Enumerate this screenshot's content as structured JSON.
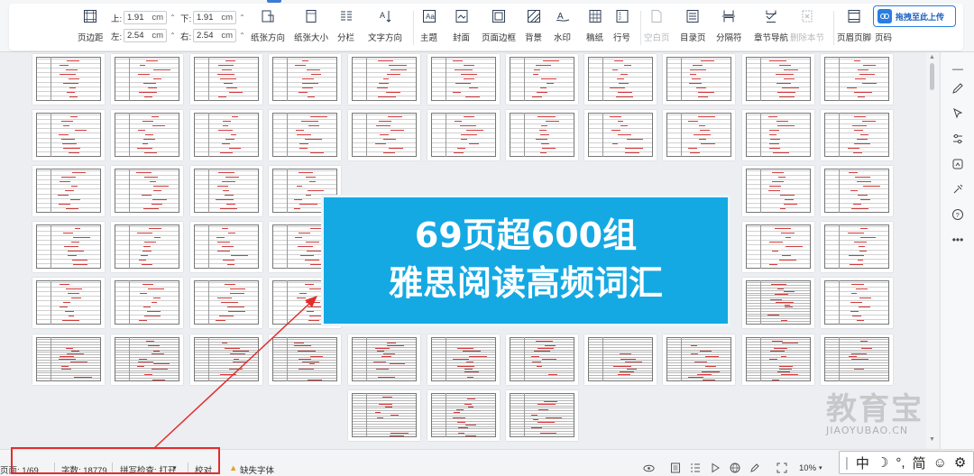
{
  "ribbon": {
    "tools": [
      {
        "id": "margins",
        "label": "页边距",
        "icon": "page-margins-icon"
      },
      {
        "id": "orientation",
        "label": "纸张方向",
        "icon": "orientation-icon"
      },
      {
        "id": "paper-size",
        "label": "纸张大小",
        "icon": "paper-size-icon"
      },
      {
        "id": "columns",
        "label": "分栏",
        "icon": "columns-icon"
      },
      {
        "id": "text-direction",
        "label": "文字方向",
        "icon": "text-direction-icon"
      },
      {
        "id": "theme",
        "label": "主题",
        "icon": "theme-icon"
      },
      {
        "id": "cover",
        "label": "封面",
        "icon": "cover-icon"
      },
      {
        "id": "page-border",
        "label": "页面边框",
        "icon": "page-border-icon"
      },
      {
        "id": "background",
        "label": "背景",
        "icon": "background-icon"
      },
      {
        "id": "watermark",
        "label": "水印",
        "icon": "watermark-icon"
      },
      {
        "id": "manuscript",
        "label": "稿纸",
        "icon": "manuscript-icon"
      },
      {
        "id": "line-number",
        "label": "行号",
        "icon": "line-number-icon"
      },
      {
        "id": "blank-page",
        "label": "空白页",
        "icon": "blank-page-icon",
        "disabled": true
      },
      {
        "id": "toc-page",
        "label": "目录页",
        "icon": "toc-page-icon"
      },
      {
        "id": "separator",
        "label": "分隔符",
        "icon": "separator-icon"
      },
      {
        "id": "section-nav",
        "label": "章节导航",
        "icon": "section-nav-icon"
      },
      {
        "id": "delete-section",
        "label": "删除本节",
        "icon": "delete-section-icon",
        "disabled": true
      },
      {
        "id": "header-footer",
        "label": "页眉页脚",
        "icon": "header-footer-icon"
      },
      {
        "id": "page-number",
        "label": "页码",
        "icon": "page-number-icon"
      }
    ],
    "margins": {
      "top_label": "上:",
      "top": "1.91",
      "bottom_label": "下:",
      "bottom": "1.91",
      "left_label": "左:",
      "left": "2.54",
      "right_label": "右:",
      "right": "2.54",
      "unit": "cm"
    },
    "upload_button": "拖拽至此上传"
  },
  "banner": {
    "line1": "69页超600组",
    "line2": "雅思阅读高频词汇"
  },
  "status": {
    "page": "页面: 1/69",
    "words": "字数: 18779",
    "spell_check": "拼写检查: 打开",
    "proof": "校对",
    "missing_font": "缺失字体",
    "zoom": "10%"
  },
  "watermark": {
    "cn": "教育宝",
    "en": "JIAOYUBAO.CN"
  },
  "ime": {
    "mode": "中",
    "punct": "°,",
    "script": "简"
  },
  "colors": {
    "banner_bg": "#15a9e4",
    "highlight_border": "#e32d2d",
    "arrow": "#e32d2d",
    "accent_blue": "#2a7de1"
  }
}
